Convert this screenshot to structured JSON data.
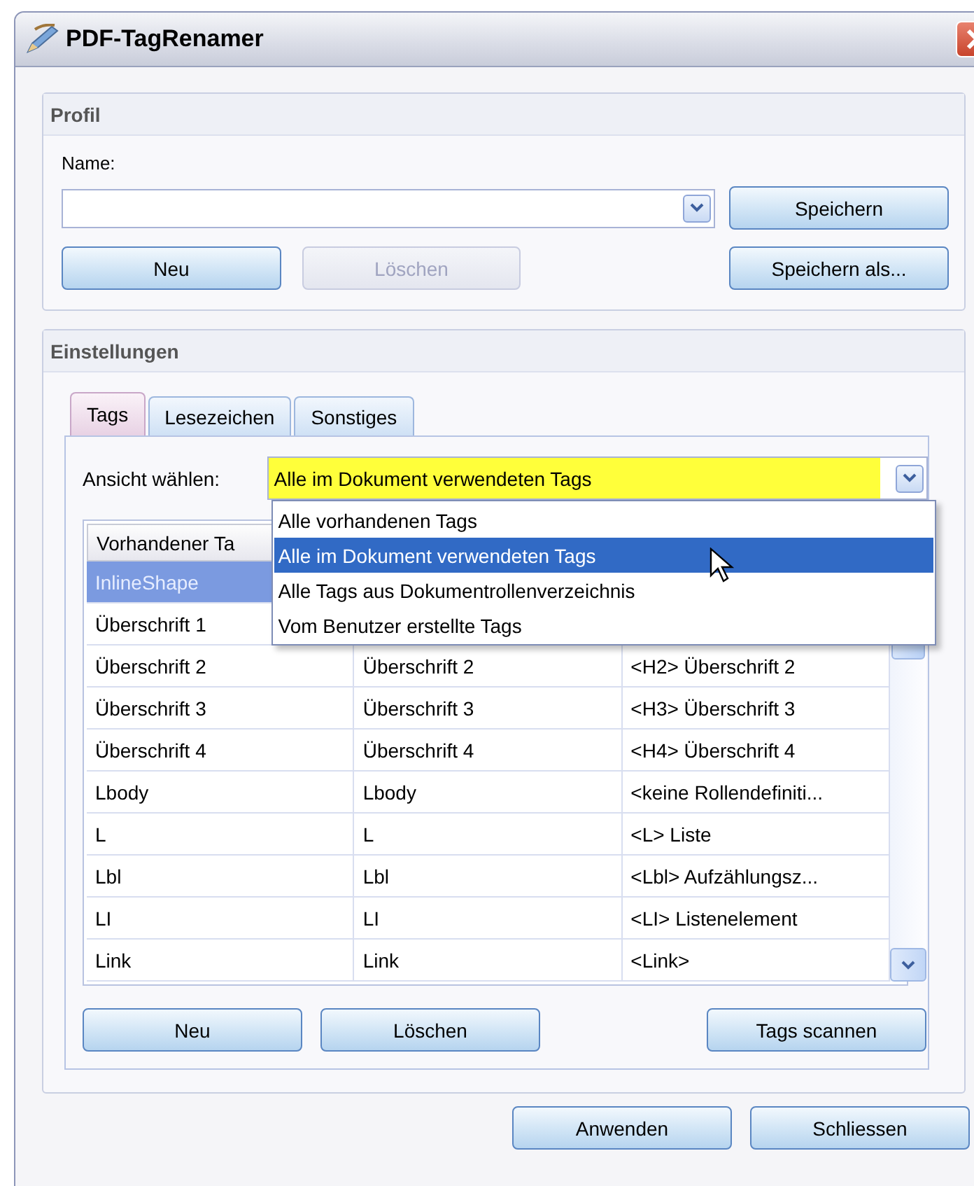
{
  "window": {
    "title": "PDF-TagRenamer"
  },
  "profile": {
    "title": "Profil",
    "name_label": "Name:",
    "buttons": [
      {
        "label": "Speichern",
        "disabled": false
      },
      {
        "label": "Neu",
        "disabled": false
      },
      {
        "label": "Löschen",
        "disabled": true
      },
      {
        "label": "Speichern als...",
        "disabled": false
      }
    ]
  },
  "settings": {
    "title": "Einstellungen",
    "tabs": [
      {
        "label": "Tags",
        "selected": true
      },
      {
        "label": "Lesezeichen",
        "selected": false
      },
      {
        "label": "Sonstiges",
        "selected": false
      }
    ],
    "view_label": "Ansicht wählen:",
    "view_value": "Alle im Dokument verwendeten Tags",
    "view_options": [
      {
        "label": "Alle vorhandenen Tags",
        "selected": false
      },
      {
        "label": "Alle im Dokument verwendeten Tags",
        "selected": true
      },
      {
        "label": "Alle Tags aus Dokumentrollenverzeichnis",
        "selected": false
      },
      {
        "label": "Vom Benutzer erstellte Tags",
        "selected": false
      }
    ],
    "table": {
      "columns": [
        "Vorhandener Ta"
      ],
      "rows": [
        {
          "cells": [
            "InlineShape"
          ],
          "selected": true
        },
        {
          "cells": [
            "Überschrift 1"
          ],
          "selected": false
        },
        {
          "cells": [
            "Überschrift 2",
            "Überschrift 2",
            "<H2> Überschrift 2"
          ],
          "selected": false
        },
        {
          "cells": [
            "Überschrift 3",
            "Überschrift 3",
            "<H3> Überschrift 3"
          ],
          "selected": false
        },
        {
          "cells": [
            "Überschrift 4",
            "Überschrift 4",
            "<H4> Überschrift 4"
          ],
          "selected": false
        },
        {
          "cells": [
            "Lbody",
            "Lbody",
            "<keine Rollendefiniti..."
          ],
          "selected": false
        },
        {
          "cells": [
            "L",
            "L",
            "<L> Liste"
          ],
          "selected": false
        },
        {
          "cells": [
            "Lbl",
            "Lbl",
            "<Lbl> Aufzählungsz..."
          ],
          "selected": false
        },
        {
          "cells": [
            "LI",
            "LI",
            "<LI> Listenelement"
          ],
          "selected": false
        },
        {
          "cells": [
            "Link",
            "Link",
            "<Link>"
          ],
          "selected": false
        }
      ]
    },
    "buttons": [
      {
        "label": "Neu",
        "disabled": false
      },
      {
        "label": "Löschen",
        "disabled": false
      },
      {
        "label": "Tags scannen",
        "disabled": false
      }
    ]
  },
  "footer_buttons": [
    {
      "label": "Anwenden",
      "disabled": false
    },
    {
      "label": "Schliessen",
      "disabled": false
    }
  ]
}
